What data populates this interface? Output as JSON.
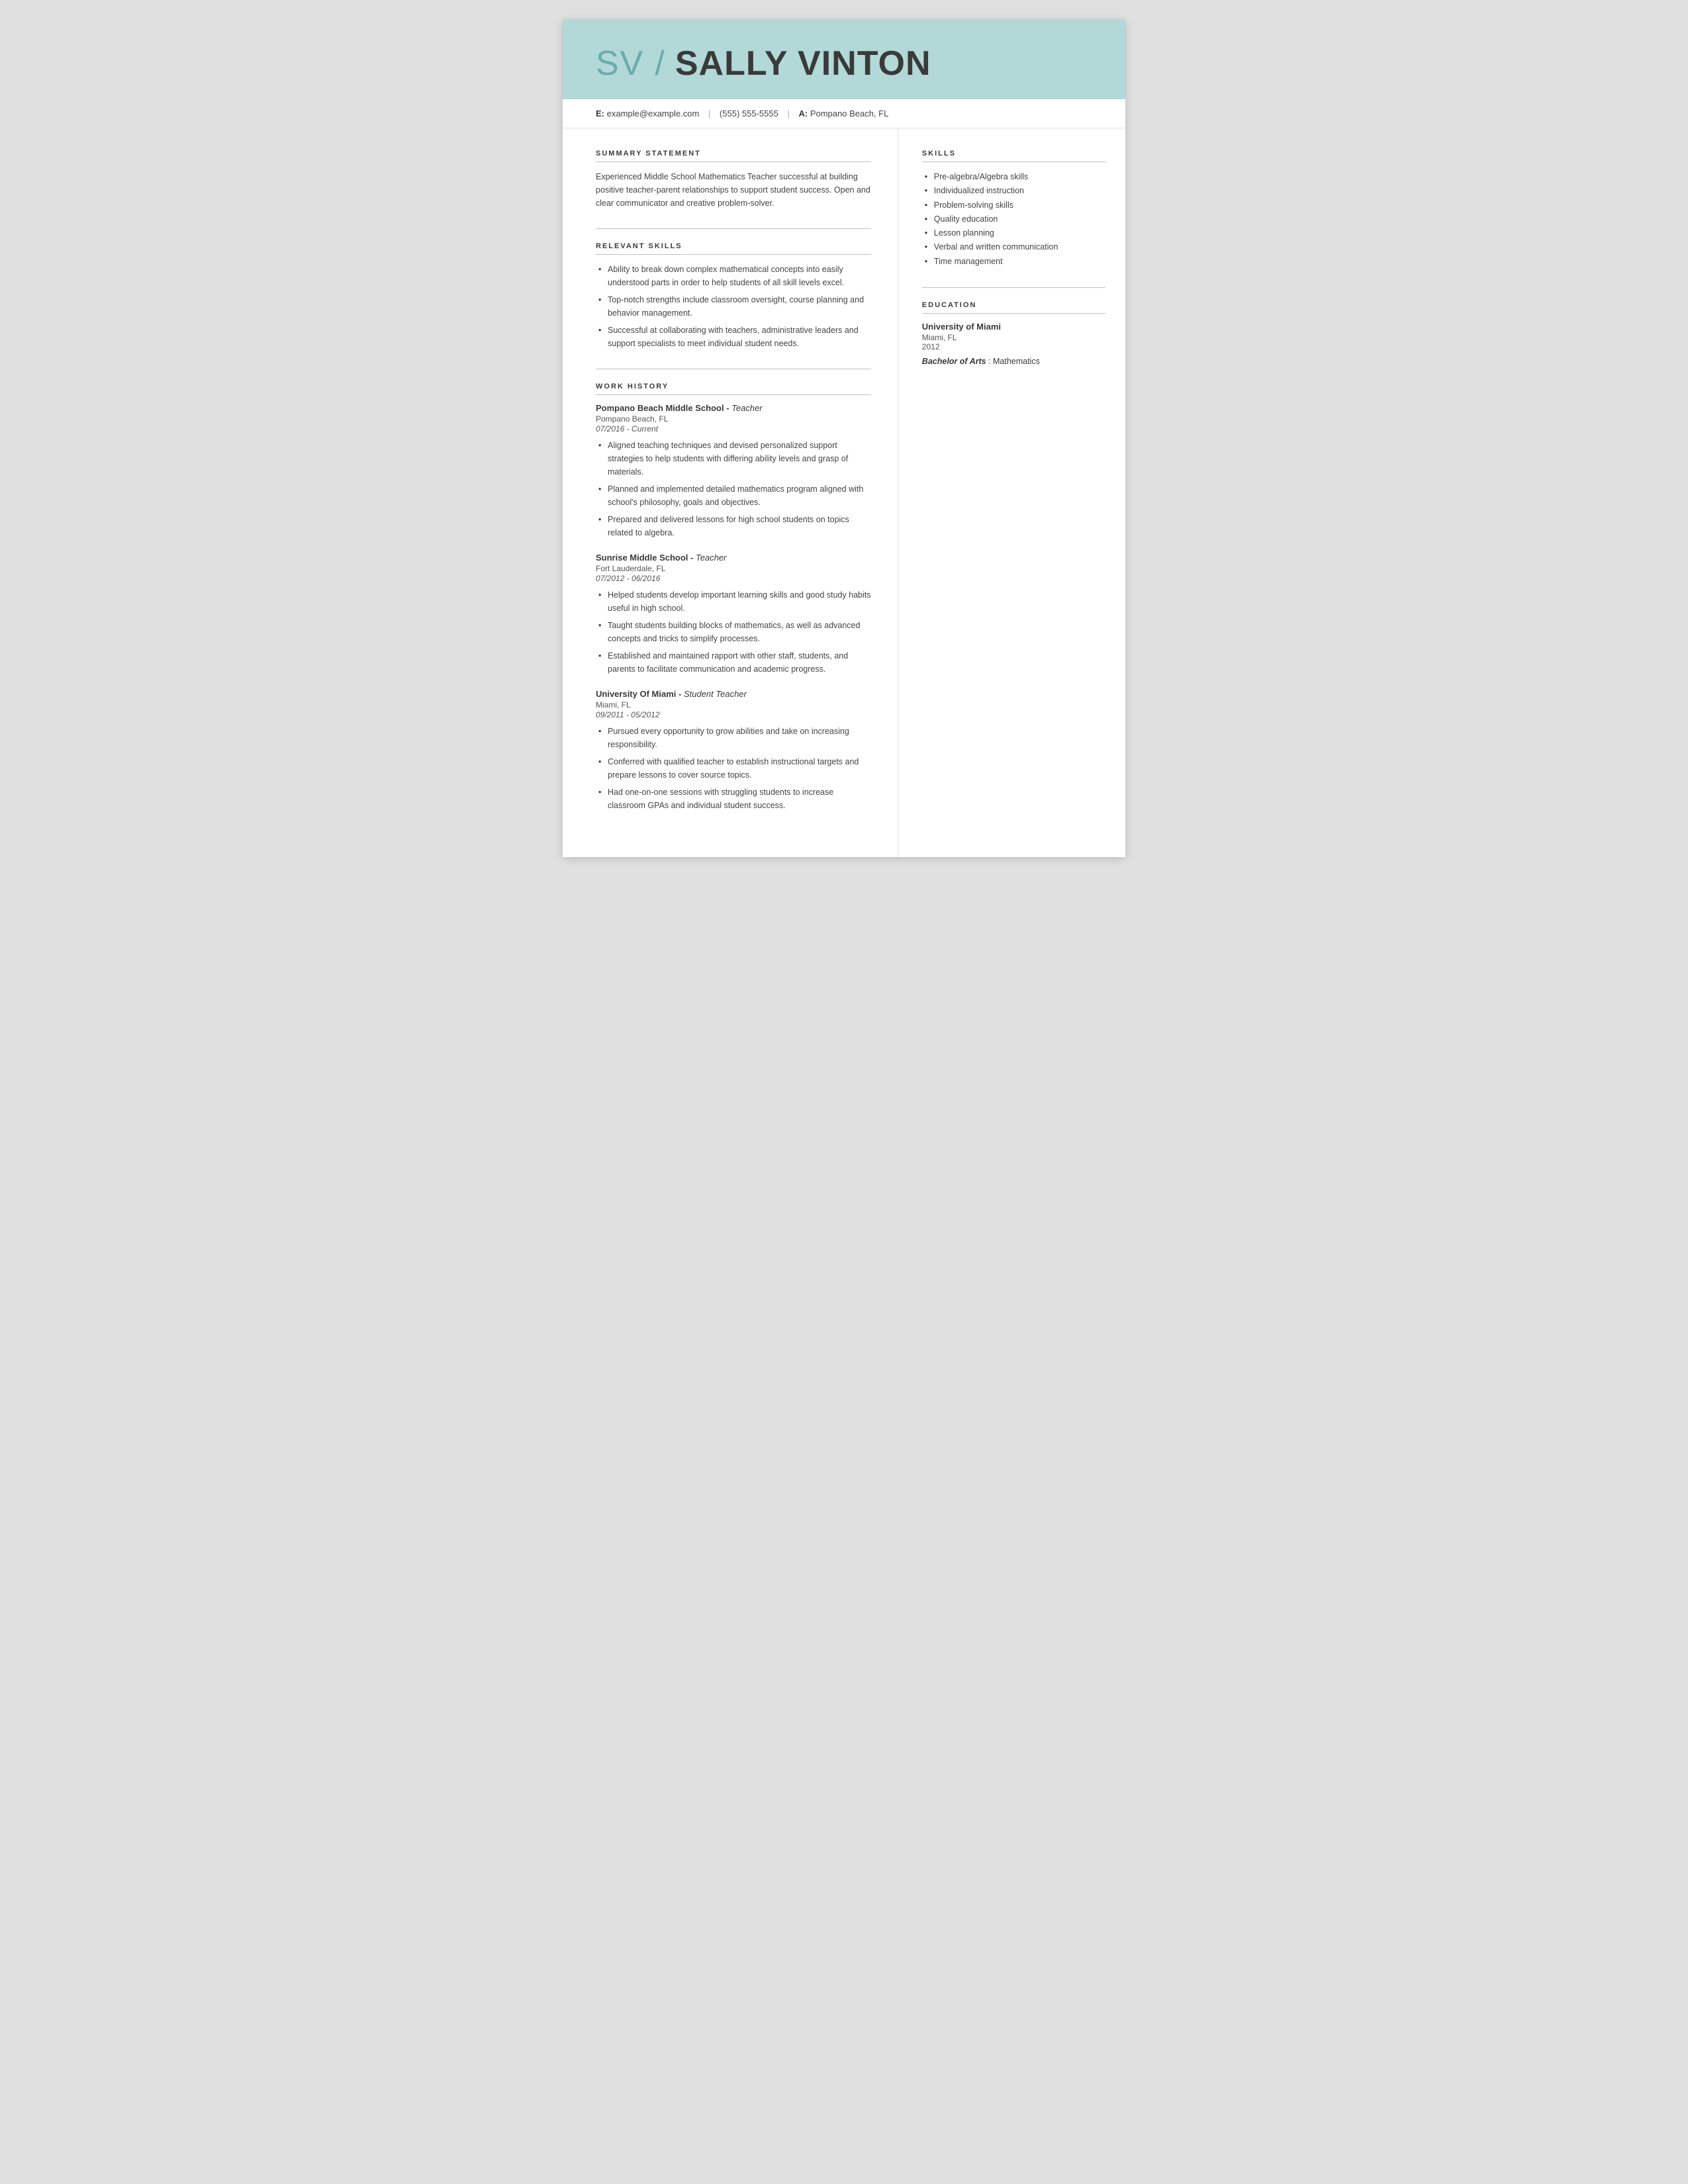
{
  "header": {
    "initials": "SV",
    "slash": "/",
    "name": "SALLY VINTON"
  },
  "contact": {
    "email_label": "E:",
    "email": "example@example.com",
    "phone": "(555) 555-5555",
    "address_label": "A:",
    "address": "Pompano Beach, FL"
  },
  "summary": {
    "title": "SUMMARY STATEMENT",
    "text": "Experienced Middle School Mathematics Teacher successful at building positive teacher-parent relationships to support student success. Open and clear communicator and creative problem-solver."
  },
  "relevant_skills": {
    "title": "RELEVANT SKILLS",
    "items": [
      "Ability to break down complex mathematical concepts into easily understood parts in order to help students of all skill levels excel.",
      "Top-notch strengths include classroom oversight, course planning and behavior management.",
      "Successful at collaborating with teachers, administrative leaders and support specialists to meet individual student needs."
    ]
  },
  "work_history": {
    "title": "WORK HISTORY",
    "entries": [
      {
        "org": "Pompano Beach Middle School",
        "role": "Teacher",
        "location": "Pompano Beach, FL",
        "dates": "07/2016 - Current",
        "bullets": [
          "Aligned teaching techniques and devised personalized support strategies to help students with differing ability levels and grasp of materials.",
          "Planned and implemented detailed mathematics program aligned with school's philosophy, goals and objectives.",
          "Prepared and delivered lessons for high school students on topics related to algebra."
        ]
      },
      {
        "org": "Sunrise Middle School",
        "role": "Teacher",
        "location": "Fort Lauderdale, FL",
        "dates": "07/2012 - 06/2016",
        "bullets": [
          "Helped students develop important learning skills and good study habits useful in high school.",
          "Taught students building blocks of mathematics, as well as advanced concepts and tricks to simplify processes.",
          "Established and maintained rapport with other staff, students, and parents to facilitate communication and academic progress."
        ]
      },
      {
        "org": "University Of Miami",
        "role": "Student Teacher",
        "location": "Miami, FL",
        "dates": "09/2011 - 05/2012",
        "bullets": [
          "Pursued every opportunity to grow abilities and take on increasing responsibility.",
          "Conferred with qualified teacher to establish instructional targets and prepare lessons to cover source topics.",
          "Had one-on-one sessions with struggling students to increase classroom GPAs and individual student success."
        ]
      }
    ]
  },
  "skills": {
    "title": "SKILLS",
    "items": [
      "Pre-algebra/Algebra skills",
      "Individualized instruction",
      "Problem-solving skills",
      "Quality education",
      "Lesson planning",
      "Verbal and written communication",
      "Time management"
    ]
  },
  "education": {
    "title": "EDUCATION",
    "entries": [
      {
        "org": "University of Miami",
        "location": "Miami, FL",
        "year": "2012",
        "degree": "Bachelor of Arts",
        "field": "Mathematics"
      }
    ]
  }
}
